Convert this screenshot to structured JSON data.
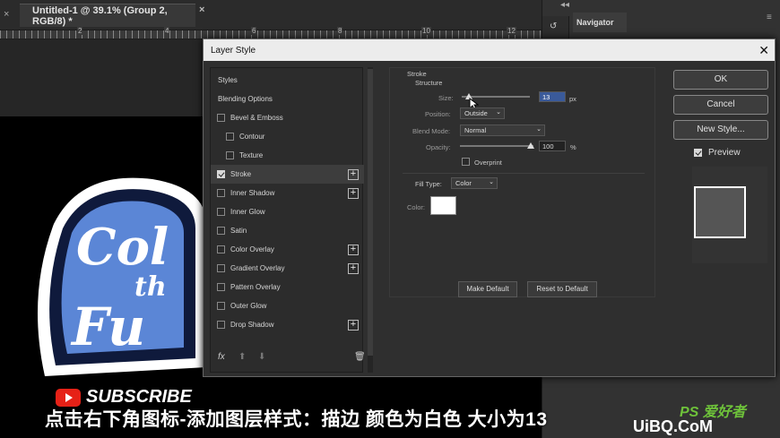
{
  "document_tab": {
    "title": "Untitled-1 @ 39.1% (Group 2, RGB/8) *"
  },
  "ruler": {
    "marks": [
      "2",
      "4",
      "6",
      "8",
      "10",
      "12"
    ]
  },
  "navigator": {
    "tab_label": "Navigator"
  },
  "dialog": {
    "title": "Layer Style",
    "styles_header": "Styles",
    "blending_options": "Blending Options",
    "effects": [
      {
        "label": "Bevel & Emboss",
        "checked": false,
        "plus": false
      },
      {
        "label": "Contour",
        "checked": false,
        "plus": false
      },
      {
        "label": "Texture",
        "checked": false,
        "plus": false
      },
      {
        "label": "Stroke",
        "checked": true,
        "plus": true
      },
      {
        "label": "Inner Shadow",
        "checked": false,
        "plus": true
      },
      {
        "label": "Inner Glow",
        "checked": false,
        "plus": false
      },
      {
        "label": "Satin",
        "checked": false,
        "plus": false
      },
      {
        "label": "Color Overlay",
        "checked": false,
        "plus": true
      },
      {
        "label": "Gradient Overlay",
        "checked": false,
        "plus": true
      },
      {
        "label": "Pattern Overlay",
        "checked": false,
        "plus": false
      },
      {
        "label": "Outer Glow",
        "checked": false,
        "plus": false
      },
      {
        "label": "Drop Shadow",
        "checked": false,
        "plus": true
      }
    ],
    "fx_label": "fx",
    "stroke": {
      "heading": "Stroke",
      "structure": "Structure",
      "size_label": "Size:",
      "size_value": "13",
      "size_unit": "px",
      "position_label": "Position:",
      "position_value": "Outside",
      "blend_label": "Blend Mode:",
      "blend_value": "Normal",
      "opacity_label": "Opacity:",
      "opacity_value": "100",
      "opacity_unit": "%",
      "overprint_label": "Overprint",
      "fill_type_label": "Fill Type:",
      "fill_type_value": "Color",
      "color_label": "Color:",
      "color_value": "#ffffff",
      "make_default": "Make Default",
      "reset_default": "Reset to Default"
    },
    "buttons": {
      "ok": "OK",
      "cancel": "Cancel",
      "new_style": "New Style..."
    },
    "preview_label": "Preview",
    "preview_checked": true
  },
  "overlay": {
    "subscribe": "SUBSCRIBE",
    "caption": "点击右下角图标-添加图层样式：描边 颜色为白色 大小为13",
    "brand": "PS 爱好者",
    "url": "UiBQ.CoM"
  }
}
